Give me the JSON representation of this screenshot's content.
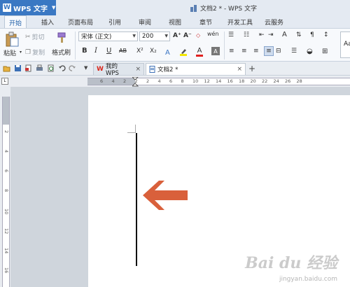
{
  "app": {
    "name": "WPS 文字",
    "logo": "W"
  },
  "window": {
    "title": "文档2 * - WPS 文字"
  },
  "ribbon_tabs": [
    "开始",
    "插入",
    "页面布局",
    "引用",
    "审阅",
    "视图",
    "章节",
    "开发工具",
    "云服务"
  ],
  "clipboard": {
    "paste": "粘贴",
    "cut": "剪切",
    "copy": "复制",
    "format_painter": "格式刷"
  },
  "font": {
    "name": "宋体 (正文)",
    "size": "200"
  },
  "format_buttons": {
    "bold": "B",
    "italic": "I",
    "underline": "U",
    "strike": "AB",
    "superscript": "X²",
    "subscript": "X₂",
    "font_color": "A",
    "grow": "A⁺",
    "shrink": "A⁻",
    "phonetic": "wén"
  },
  "doc_tabs": [
    {
      "label": "我的WPS",
      "close": "×"
    },
    {
      "label": "文档2 *",
      "close": "×"
    }
  ],
  "new_tab": "+",
  "hruler_numbers": [
    "6",
    "4",
    "2",
    "2",
    "2",
    "4",
    "6",
    "8",
    "10",
    "12",
    "14",
    "16",
    "18",
    "20",
    "22",
    "24",
    "26",
    "28"
  ],
  "vruler_numbers": [
    "2",
    "4",
    "6",
    "8",
    "10",
    "12",
    "14",
    "16",
    "18"
  ],
  "arrow_color": "#d9603b",
  "watermark": {
    "text": "Bai du 经验",
    "sub": "jingyan.baidu.com"
  }
}
